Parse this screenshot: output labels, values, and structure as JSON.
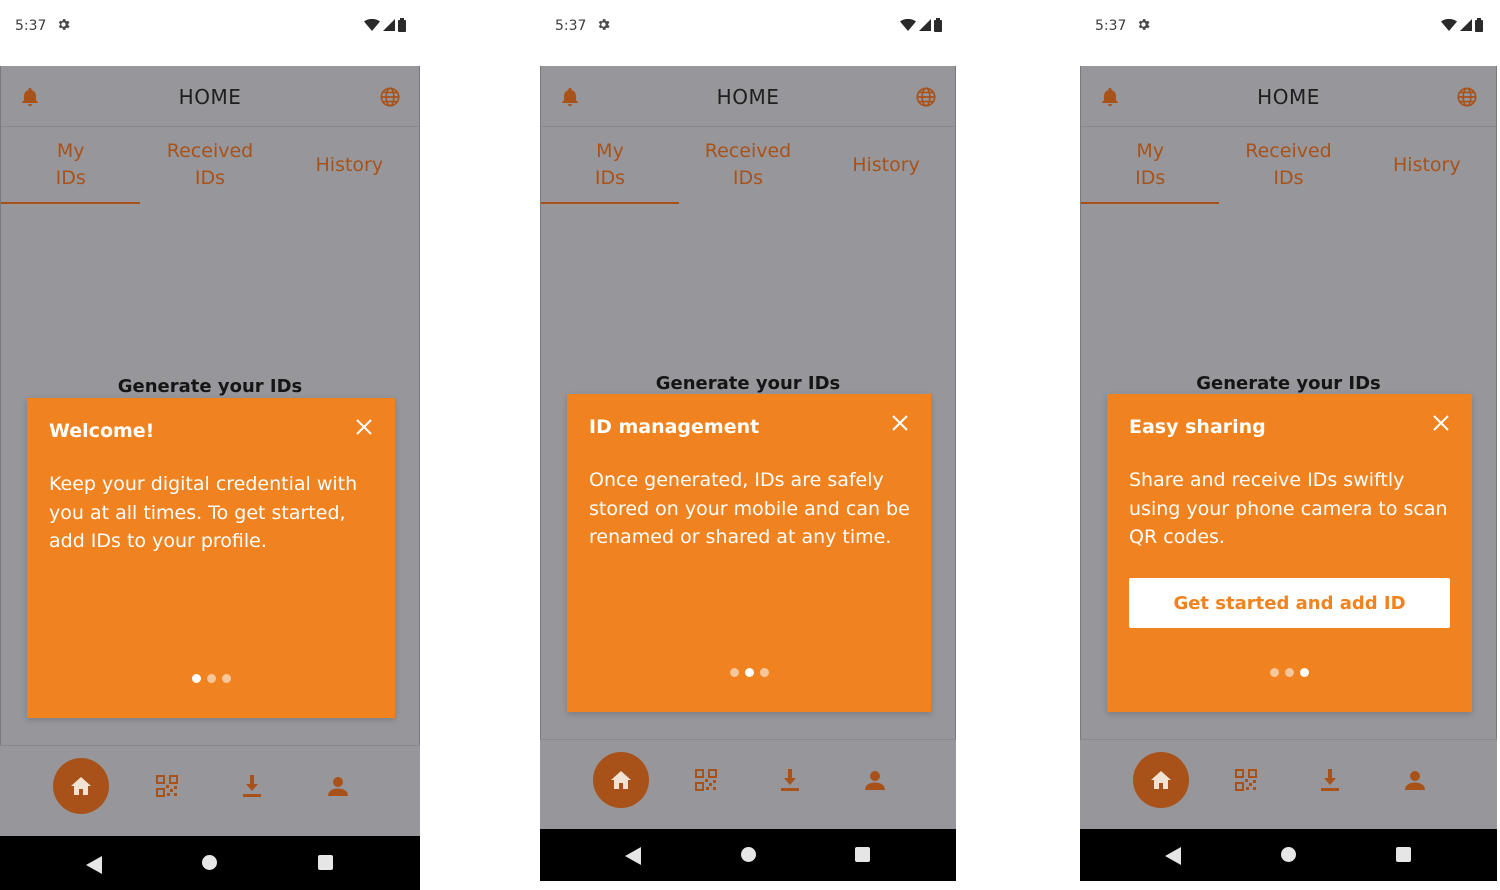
{
  "status_bar": {
    "time": "5:37"
  },
  "app": {
    "title": "HOME",
    "tabs": [
      {
        "label_line1": "My",
        "label_line2": "IDs",
        "active": true
      },
      {
        "label_line1": "Received",
        "label_line2": "IDs",
        "active": false
      },
      {
        "label_line1": "History",
        "label_line2": "",
        "active": false
      }
    ],
    "empty_heading": "Generate your IDs",
    "nav_icons": [
      "home-icon",
      "qr-code-icon",
      "download-icon",
      "person-icon"
    ],
    "accent_color": "#a8521a",
    "card_color": "#f0821f"
  },
  "screens": [
    {
      "card_title": "Welcome!",
      "card_text": "Keep your digital credential with you at all times. To get started, add IDs to your profile.",
      "active_dot": 1,
      "cta_label": ""
    },
    {
      "card_title": "ID management",
      "card_text": "Once generated, IDs are safely stored on your mobile and can be renamed or shared at any time.",
      "active_dot": 2,
      "cta_label": ""
    },
    {
      "card_title": "Easy sharing",
      "card_text": "Share and receive IDs swiftly using your phone camera to scan QR codes.",
      "active_dot": 3,
      "cta_label": "Get started and add ID"
    }
  ]
}
